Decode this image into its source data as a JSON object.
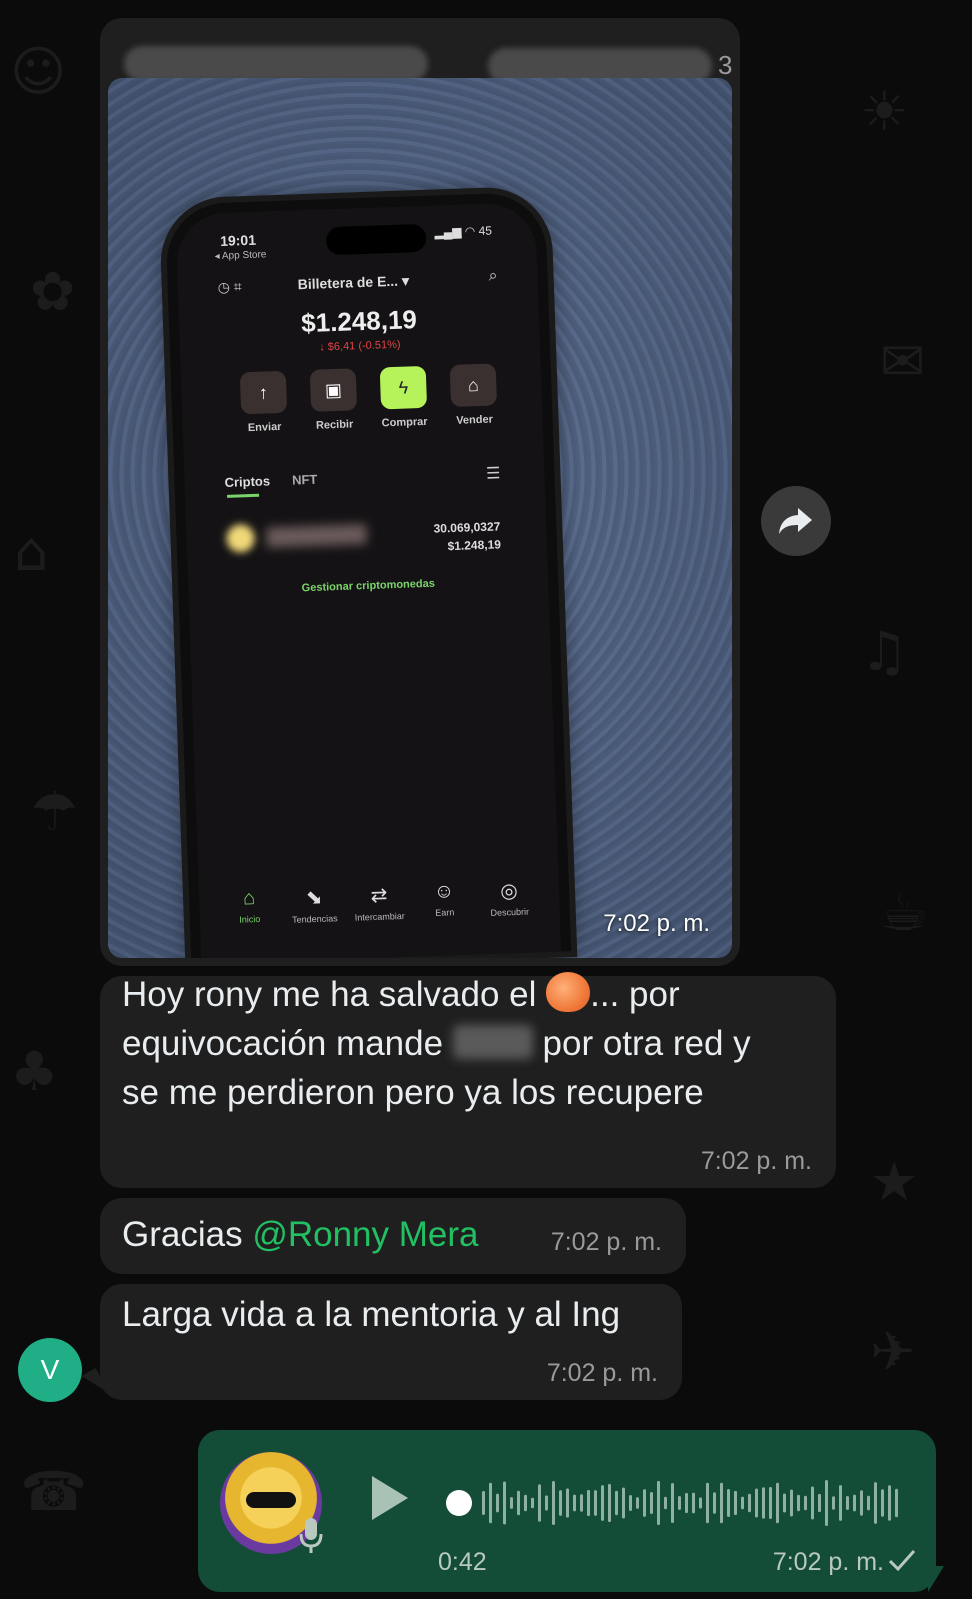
{
  "image_message": {
    "header_char": "3",
    "time": "7:02 p. m.",
    "phone": {
      "clock": "19:01",
      "back_app": "◂ App Store",
      "battery": "45",
      "wallet_name": "Billetera de E...",
      "balance": "$1.248,19",
      "change": "↓ $6,41 (-0.51%)",
      "actions": [
        {
          "label": "Enviar",
          "icon": "arrow-up-icon",
          "glyph": "↑"
        },
        {
          "label": "Recibir",
          "icon": "copy-icon",
          "glyph": "▣"
        },
        {
          "label": "Comprar",
          "icon": "lightning-icon",
          "glyph": "ϟ"
        },
        {
          "label": "Vender",
          "icon": "bank-icon",
          "glyph": "⌂"
        }
      ],
      "tabs": [
        "Criptos",
        "NFT"
      ],
      "asset_amount": "30.069,0327",
      "asset_value": "$1.248,19",
      "manage_link": "Gestionar criptomonedas",
      "nav": [
        {
          "label": "Inicio",
          "glyph": "⌂"
        },
        {
          "label": "Tendencias",
          "glyph": "⬊"
        },
        {
          "label": "Intercambiar",
          "glyph": "⇄"
        },
        {
          "label": "Earn",
          "glyph": "☺"
        },
        {
          "label": "Descubrir",
          "glyph": "◎"
        }
      ]
    }
  },
  "messages": [
    {
      "line1_a": "Hoy rony me ha salvado el",
      "line1_b": "... por",
      "line2_a": "equivocación mande",
      "line2_b": "por otra red y",
      "line3": "se me perdieron pero ya los recupere",
      "time": "7:02 p. m."
    },
    {
      "text": "Gracias ",
      "mention": "@Ronny Mera",
      "time": "7:02 p. m."
    },
    {
      "text": "Larga vida a la mentoria y al Ing",
      "time": "7:02 p. m."
    }
  ],
  "sender_avatar": "V",
  "voice_note": {
    "duration": "0:42",
    "time": "7:02 p. m.",
    "status": "sent"
  },
  "colors": {
    "chat_bg": "#0b0b0b",
    "incoming_bubble": "#1f1f1f",
    "outgoing_bubble": "#144d37",
    "mention": "#21c063",
    "avatar": "#1fae86"
  }
}
